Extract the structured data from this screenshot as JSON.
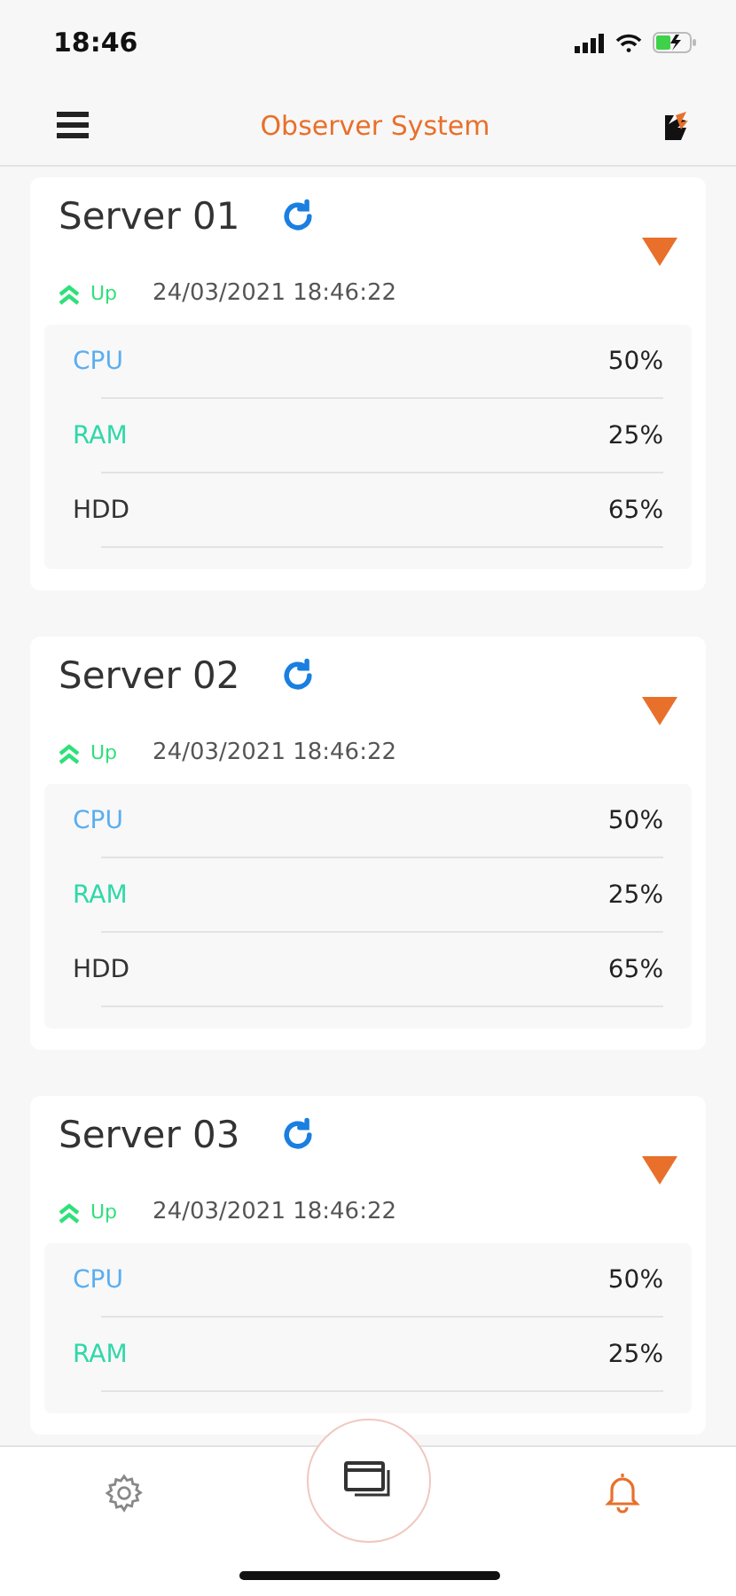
{
  "status_bar": {
    "time": "18:46"
  },
  "header": {
    "title": "Observer System"
  },
  "servers": [
    {
      "name": "Server 01",
      "status": "Up",
      "up": true,
      "timestamp": "24/03/2021 18:46:22",
      "metrics": [
        {
          "label": "CPU",
          "value": "50%",
          "color": "#5aaef0"
        },
        {
          "label": "RAM",
          "value": "25%",
          "color": "#2fd8a8"
        },
        {
          "label": "HDD",
          "value": "65%",
          "color": "#333333"
        }
      ]
    },
    {
      "name": "Server 02",
      "status": "Up",
      "up": true,
      "timestamp": "24/03/2021 18:46:22",
      "metrics": [
        {
          "label": "CPU",
          "value": "50%",
          "color": "#5aaef0"
        },
        {
          "label": "RAM",
          "value": "25%",
          "color": "#2fd8a8"
        },
        {
          "label": "HDD",
          "value": "65%",
          "color": "#333333"
        }
      ]
    },
    {
      "name": "Server 03",
      "status": "Up",
      "up": true,
      "timestamp": "24/03/2021 18:46:22",
      "metrics": [
        {
          "label": "CPU",
          "value": "50%",
          "color": "#5aaef0"
        },
        {
          "label": "RAM",
          "value": "25%",
          "color": "#2fd8a8"
        }
      ]
    }
  ],
  "bottom_nav": [
    {
      "kind": "settings",
      "selected": false
    },
    {
      "kind": "windows",
      "selected": false
    },
    {
      "kind": "bell",
      "selected": true
    }
  ]
}
